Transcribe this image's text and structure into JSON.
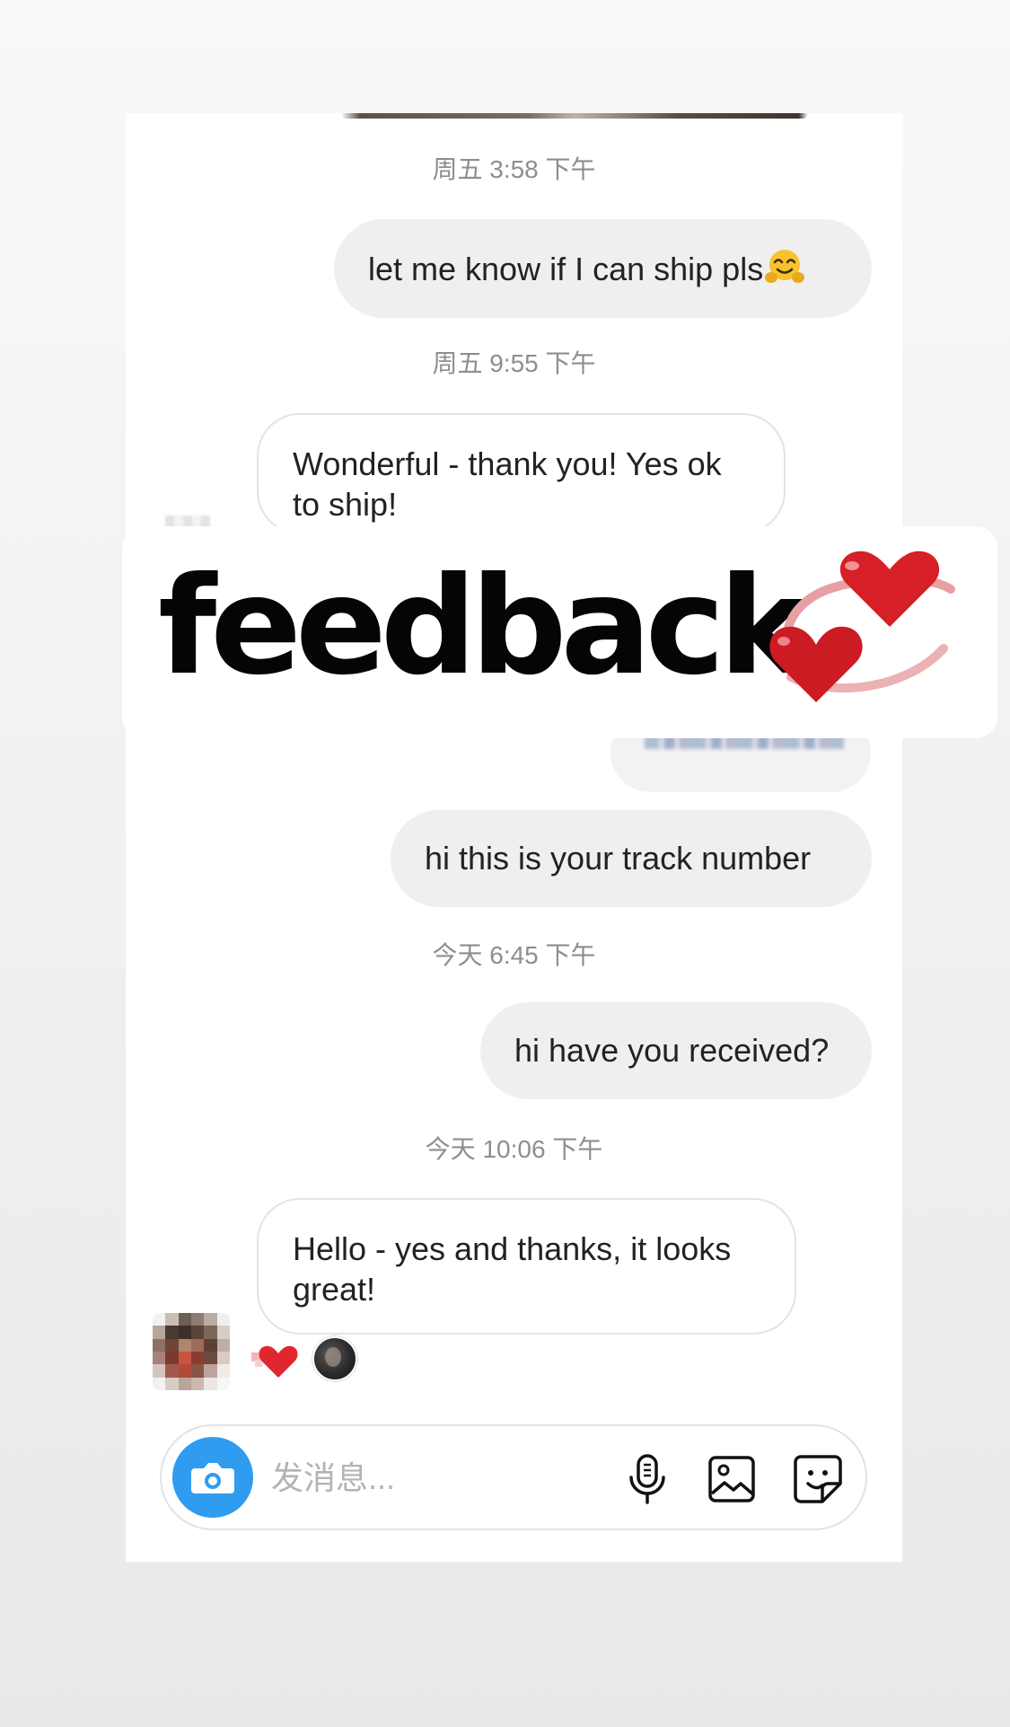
{
  "conversation": {
    "messages": [
      {
        "timestamp": "周五 3:58 下午",
        "text": "let me know if I can ship pls"
      },
      {
        "timestamp": "周五 9:55 下午",
        "text": "Wonderful - thank you! Yes ok to ship!"
      },
      {
        "text": "hi this is your track number"
      },
      {
        "timestamp": "今天 6:45 下午",
        "text": "hi have you received?"
      },
      {
        "timestamp": "今天 10:06 下午",
        "text": "Hello - yes and thanks, it looks great!"
      }
    ]
  },
  "overlay": {
    "text": "feedback"
  },
  "composer": {
    "placeholder": "发消息..."
  },
  "colors": {
    "sent_bubble": "#efefef",
    "received_border": "#e3e3e3",
    "camera_button": "#2f9cf0",
    "heart": "#e0262e",
    "timestamp": "#8e8e8e"
  },
  "icons": [
    "hugging-face-emoji",
    "double-hearts-sticker",
    "heart-reaction-icon",
    "camera-icon",
    "microphone-icon",
    "gallery-icon",
    "sticker-icon"
  ]
}
